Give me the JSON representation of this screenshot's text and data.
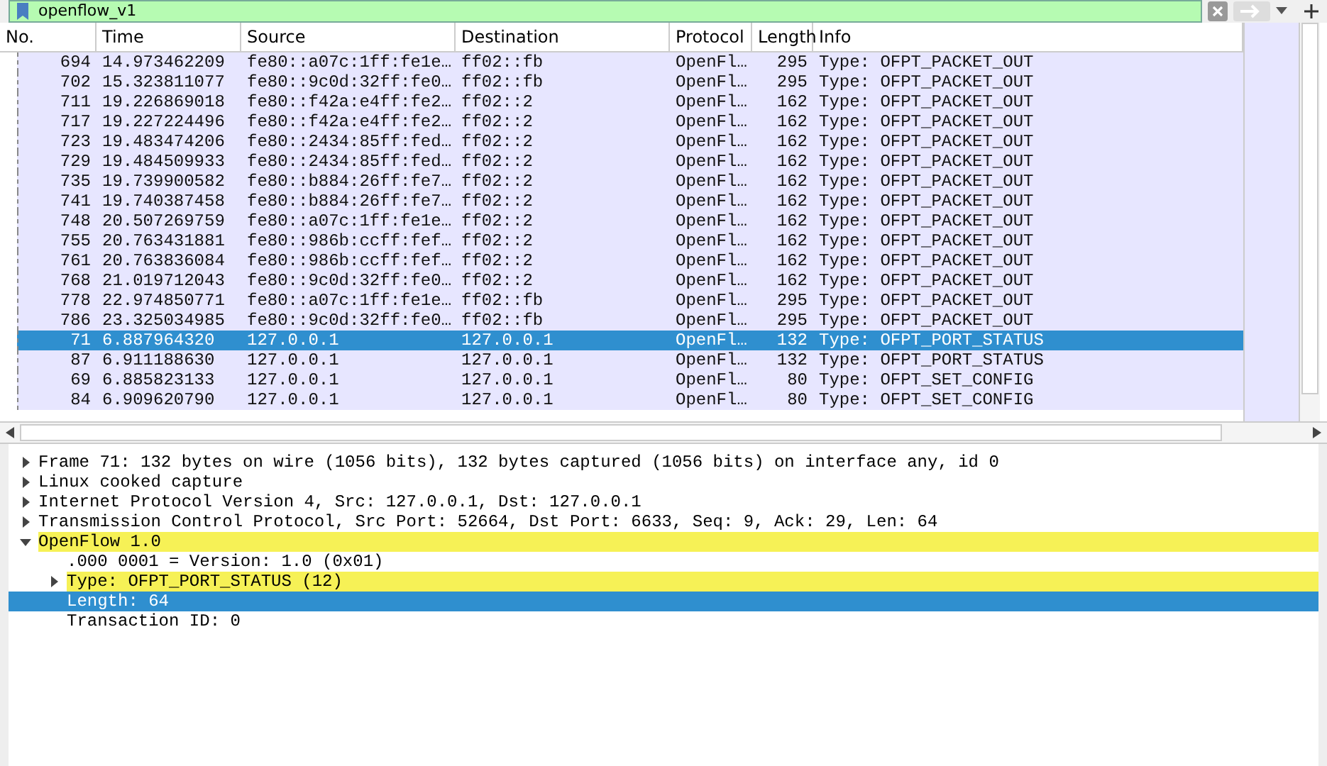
{
  "filter": {
    "value": "openflow_v1"
  },
  "columns": [
    "No.",
    "Time",
    "Source",
    "Destination",
    "Protocol",
    "Length",
    "Info"
  ],
  "packets": [
    {
      "no": "694",
      "time": "14.973462209",
      "source": "fe80::a07c:1ff:fe1e…",
      "destination": "ff02::fb",
      "protocol": "OpenFl…",
      "length": "295",
      "info": "Type: OFPT_PACKET_OUT",
      "selected": false
    },
    {
      "no": "702",
      "time": "15.323811077",
      "source": "fe80::9c0d:32ff:fe0…",
      "destination": "ff02::fb",
      "protocol": "OpenFl…",
      "length": "295",
      "info": "Type: OFPT_PACKET_OUT",
      "selected": false
    },
    {
      "no": "711",
      "time": "19.226869018",
      "source": "fe80::f42a:e4ff:fe2…",
      "destination": "ff02::2",
      "protocol": "OpenFl…",
      "length": "162",
      "info": "Type: OFPT_PACKET_OUT",
      "selected": false
    },
    {
      "no": "717",
      "time": "19.227224496",
      "source": "fe80::f42a:e4ff:fe2…",
      "destination": "ff02::2",
      "protocol": "OpenFl…",
      "length": "162",
      "info": "Type: OFPT_PACKET_OUT",
      "selected": false
    },
    {
      "no": "723",
      "time": "19.483474206",
      "source": "fe80::2434:85ff:fed…",
      "destination": "ff02::2",
      "protocol": "OpenFl…",
      "length": "162",
      "info": "Type: OFPT_PACKET_OUT",
      "selected": false
    },
    {
      "no": "729",
      "time": "19.484509933",
      "source": "fe80::2434:85ff:fed…",
      "destination": "ff02::2",
      "protocol": "OpenFl…",
      "length": "162",
      "info": "Type: OFPT_PACKET_OUT",
      "selected": false
    },
    {
      "no": "735",
      "time": "19.739900582",
      "source": "fe80::b884:26ff:fe7…",
      "destination": "ff02::2",
      "protocol": "OpenFl…",
      "length": "162",
      "info": "Type: OFPT_PACKET_OUT",
      "selected": false
    },
    {
      "no": "741",
      "time": "19.740387458",
      "source": "fe80::b884:26ff:fe7…",
      "destination": "ff02::2",
      "protocol": "OpenFl…",
      "length": "162",
      "info": "Type: OFPT_PACKET_OUT",
      "selected": false
    },
    {
      "no": "748",
      "time": "20.507269759",
      "source": "fe80::a07c:1ff:fe1e…",
      "destination": "ff02::2",
      "protocol": "OpenFl…",
      "length": "162",
      "info": "Type: OFPT_PACKET_OUT",
      "selected": false
    },
    {
      "no": "755",
      "time": "20.763431881",
      "source": "fe80::986b:ccff:fef…",
      "destination": "ff02::2",
      "protocol": "OpenFl…",
      "length": "162",
      "info": "Type: OFPT_PACKET_OUT",
      "selected": false
    },
    {
      "no": "761",
      "time": "20.763836084",
      "source": "fe80::986b:ccff:fef…",
      "destination": "ff02::2",
      "protocol": "OpenFl…",
      "length": "162",
      "info": "Type: OFPT_PACKET_OUT",
      "selected": false
    },
    {
      "no": "768",
      "time": "21.019712043",
      "source": "fe80::9c0d:32ff:fe0…",
      "destination": "ff02::2",
      "protocol": "OpenFl…",
      "length": "162",
      "info": "Type: OFPT_PACKET_OUT",
      "selected": false
    },
    {
      "no": "778",
      "time": "22.974850771",
      "source": "fe80::a07c:1ff:fe1e…",
      "destination": "ff02::fb",
      "protocol": "OpenFl…",
      "length": "295",
      "info": "Type: OFPT_PACKET_OUT",
      "selected": false
    },
    {
      "no": "786",
      "time": "23.325034985",
      "source": "fe80::9c0d:32ff:fe0…",
      "destination": "ff02::fb",
      "protocol": "OpenFl…",
      "length": "295",
      "info": "Type: OFPT_PACKET_OUT",
      "selected": false
    },
    {
      "no": "71",
      "time": "6.887964320",
      "source": "127.0.0.1",
      "destination": "127.0.0.1",
      "protocol": "OpenFl…",
      "length": "132",
      "info": "Type: OFPT_PORT_STATUS",
      "selected": true
    },
    {
      "no": "87",
      "time": "6.911188630",
      "source": "127.0.0.1",
      "destination": "127.0.0.1",
      "protocol": "OpenFl…",
      "length": "132",
      "info": "Type: OFPT_PORT_STATUS",
      "selected": false
    },
    {
      "no": "69",
      "time": "6.885823133",
      "source": "127.0.0.1",
      "destination": "127.0.0.1",
      "protocol": "OpenFl…",
      "length": "80",
      "info": "Type: OFPT_SET_CONFIG",
      "selected": false
    },
    {
      "no": "84",
      "time": "6.909620790",
      "source": "127.0.0.1",
      "destination": "127.0.0.1",
      "protocol": "OpenFl…",
      "length": "80",
      "info": "Type: OFPT_SET_CONFIG",
      "selected": false
    }
  ],
  "details": [
    {
      "label": "Frame 71: 132 bytes on wire (1056 bits), 132 bytes captured (1056 bits) on interface any, id 0",
      "expanded": false,
      "highlighted": false,
      "selected": false
    },
    {
      "label": "Linux cooked capture",
      "expanded": false,
      "highlighted": false,
      "selected": false
    },
    {
      "label": "Internet Protocol Version 4, Src: 127.0.0.1, Dst: 127.0.0.1",
      "expanded": false,
      "highlighted": false,
      "selected": false
    },
    {
      "label": "Transmission Control Protocol, Src Port: 52664, Dst Port: 6633, Seq: 9, Ack: 29, Len: 64",
      "expanded": false,
      "highlighted": false,
      "selected": false
    },
    {
      "label": "OpenFlow 1.0",
      "expanded": true,
      "highlighted": true,
      "selected": false,
      "children": [
        {
          "label": ".000 0001 = Version: 1.0 (0x01)",
          "highlighted": false,
          "selected": false
        },
        {
          "label": "Type: OFPT_PORT_STATUS (12)",
          "expanded": false,
          "highlighted": true,
          "selected": false
        },
        {
          "label": "Length: 64",
          "highlighted": false,
          "selected": true
        },
        {
          "label": "Transaction ID: 0",
          "highlighted": false,
          "selected": false
        }
      ]
    }
  ]
}
